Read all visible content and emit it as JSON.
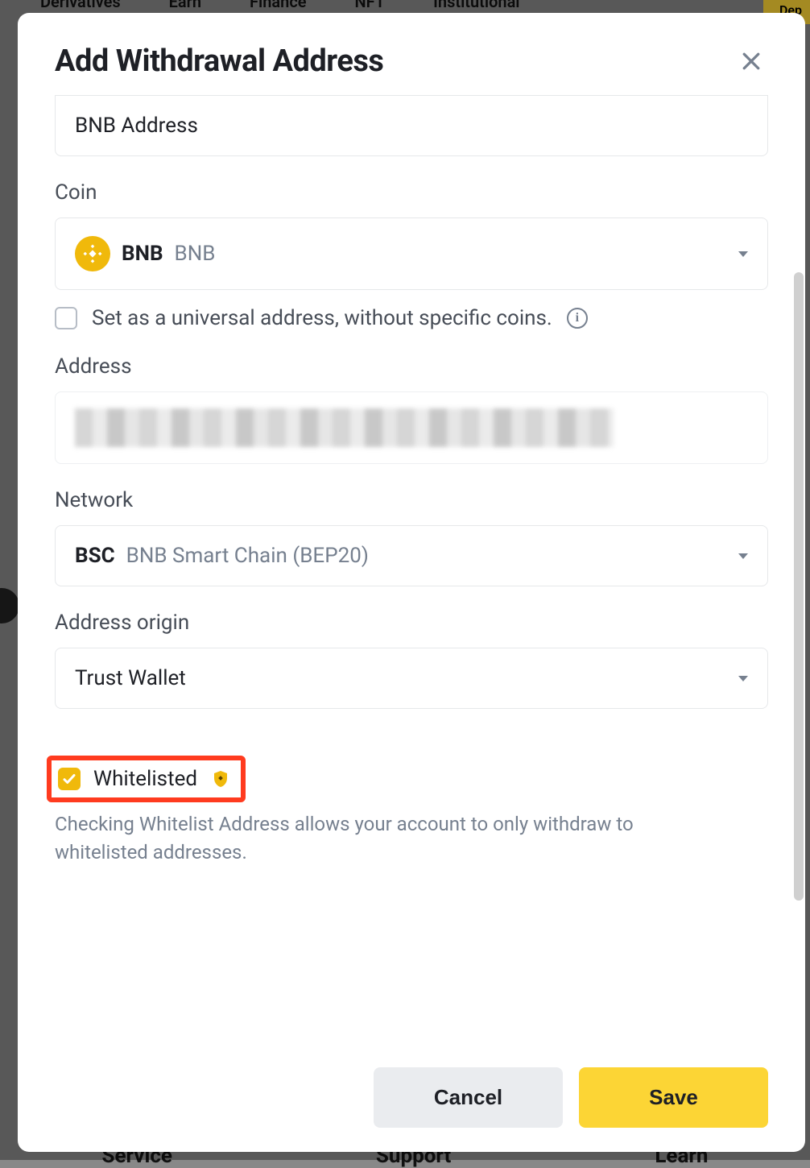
{
  "background": {
    "nav": [
      "Derivatives",
      "Earn",
      "Finance",
      "NFT",
      "Institutional"
    ],
    "deposit": "Dep",
    "footer_left": "Service",
    "footer_mid": "Support",
    "footer_right": "Learn"
  },
  "modal": {
    "title": "Add Withdrawal Address",
    "label_field": {
      "value": "BNB Address"
    },
    "coin": {
      "label": "Coin",
      "symbol": "BNB",
      "name": "BNB",
      "universal_checkbox_label": "Set as a universal address, without specific coins."
    },
    "address": {
      "label": "Address"
    },
    "network": {
      "label": "Network",
      "code": "BSC",
      "name": "BNB Smart Chain (BEP20)"
    },
    "origin": {
      "label": "Address origin",
      "value": "Trust Wallet"
    },
    "whitelist": {
      "label": "Whitelisted",
      "note": "Checking Whitelist Address allows your account to only withdraw to whitelisted addresses."
    },
    "buttons": {
      "cancel": "Cancel",
      "save": "Save"
    }
  }
}
